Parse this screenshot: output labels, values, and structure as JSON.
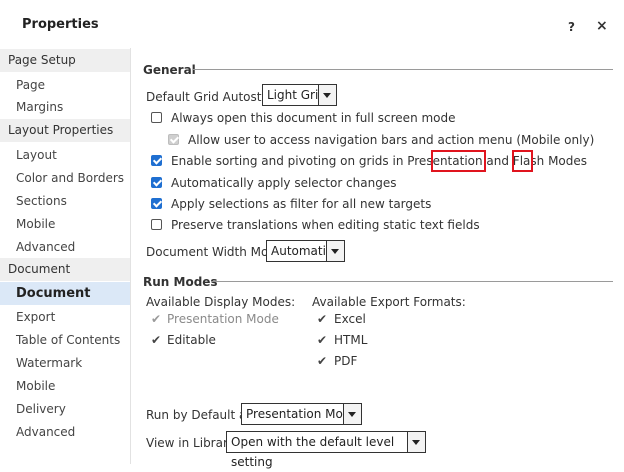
{
  "window": {
    "title": "Properties",
    "help_label": "?",
    "close_label": "×"
  },
  "sidebar": {
    "groups": [
      {
        "header": "Page Setup",
        "items": [
          "Page",
          "Margins"
        ]
      },
      {
        "header": "Layout Properties",
        "items": [
          "Layout",
          "Color and Borders",
          "Sections",
          "Mobile",
          "Advanced"
        ]
      },
      {
        "header": "Document Properties",
        "items": [
          "Document",
          "Export",
          "Table of Contents",
          "Watermark",
          "Mobile",
          "Delivery",
          "Advanced"
        ]
      }
    ],
    "active_item": "Document"
  },
  "general": {
    "title": "General",
    "grid_autostyle_label": "Default Grid Autostyle:",
    "grid_autostyle_value": "Light Grid",
    "options": [
      {
        "label": "Always open this document in full screen mode",
        "checked": false
      },
      {
        "label": "Allow user to access navigation bars and action menu (Mobile only)",
        "checked": true,
        "disabled": true
      },
      {
        "label": "Enable sorting and pivoting on grids in Presentation and Flash Modes",
        "checked": true
      },
      {
        "label": "Automatically apply selector changes",
        "checked": true
      },
      {
        "label": "Apply selections as filter for all new targets",
        "checked": true
      },
      {
        "label": "Preserve translations when editing static text fields",
        "checked": false
      }
    ],
    "width_mode_label": "Document Width Mode:",
    "width_mode_value": "Automatic"
  },
  "run_modes": {
    "title": "Run Modes",
    "display_modes_label": "Available Display Modes:",
    "display_modes": [
      {
        "label": "Presentation Mode",
        "checked": true,
        "disabled": true
      },
      {
        "label": "Editable",
        "checked": true
      }
    ],
    "export_formats_label": "Available Export Formats:",
    "export_formats": [
      {
        "label": "Excel",
        "checked": true
      },
      {
        "label": "HTML",
        "checked": true
      },
      {
        "label": "PDF",
        "checked": true
      }
    ],
    "run_default_label": "Run by Default as:",
    "run_default_value": "Presentation Mode",
    "view_library_label": "View in Library:",
    "view_library_value": "Open with the default level setting"
  },
  "colors": {
    "accent": "#1f6fd1",
    "active_bg": "#dbe8f7",
    "highlight": "#e0141e"
  }
}
